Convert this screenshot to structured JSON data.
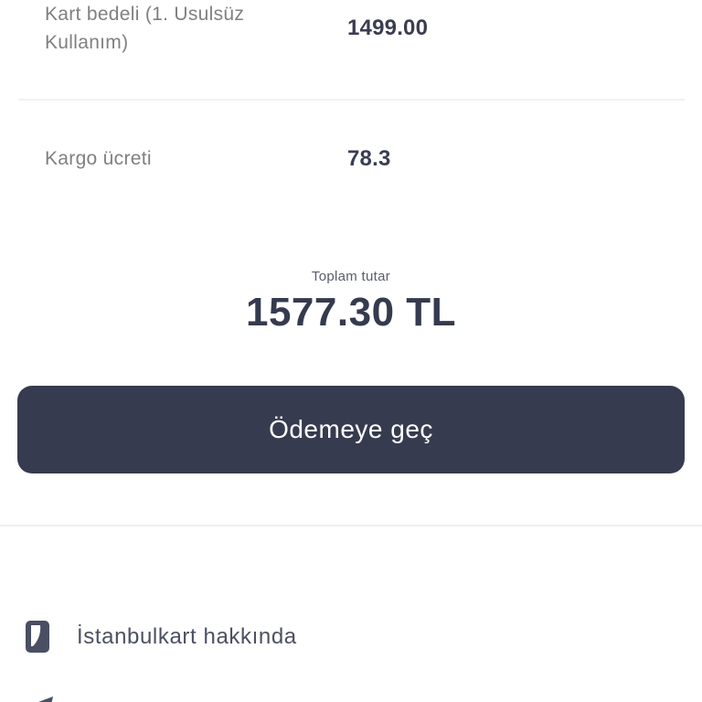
{
  "summary": {
    "card_fee": {
      "label": "Kart bedeli (1. Usulsüz Kullanım)",
      "value": "1499.00"
    },
    "cargo_fee": {
      "label": "Kargo ücreti",
      "value": "78.3"
    }
  },
  "total": {
    "label": "Toplam tutar",
    "value": "1577.30 TL"
  },
  "actions": {
    "pay_label": "Ödemeye geç"
  },
  "menu": {
    "items": [
      {
        "label": "İstanbulkart hakkında",
        "icon": "istanbulkart-card-icon"
      }
    ],
    "partial_item_icon": "send-icon"
  },
  "colors": {
    "button_bg": "#373b50",
    "value_text": "#3a3d52",
    "label_text": "#808080",
    "divider": "#eeeef0"
  }
}
